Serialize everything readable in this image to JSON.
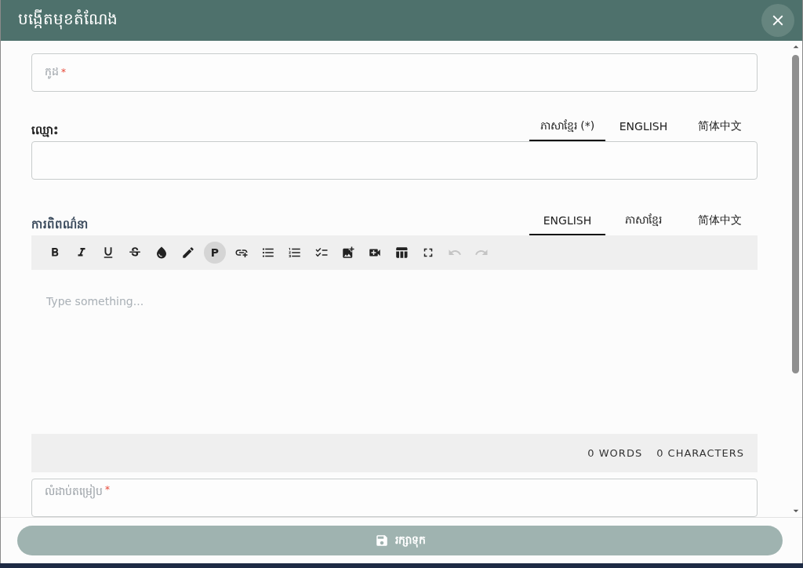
{
  "dialog": {
    "title": "បង្កើតមុខតំណែង"
  },
  "code_field": {
    "placeholder": "កូដ",
    "required_mark": "*"
  },
  "name_section": {
    "label": "ឈ្មោះ",
    "tabs": [
      {
        "label": "ភាសាខ្មែរ (*)",
        "selected": true
      },
      {
        "label": "ENGLISH",
        "selected": false
      },
      {
        "label": "简体中文",
        "selected": false
      }
    ]
  },
  "description_section": {
    "label": "ការពិពណ៌នា",
    "tabs": [
      {
        "label": "ENGLISH",
        "selected": true
      },
      {
        "label": "ភាសាខ្មែរ",
        "selected": false
      },
      {
        "label": "简体中文",
        "selected": false
      }
    ],
    "toolbar": [
      {
        "kind": "bold",
        "disabled": false
      },
      {
        "kind": "italic",
        "disabled": false
      },
      {
        "kind": "underline",
        "disabled": false
      },
      {
        "kind": "strike",
        "disabled": false
      },
      {
        "kind": "color",
        "disabled": false
      },
      {
        "kind": "highlight",
        "disabled": false
      },
      {
        "kind": "paragraph",
        "label": "P",
        "selected": true,
        "disabled": false
      },
      {
        "kind": "link",
        "disabled": false
      },
      {
        "kind": "bullets",
        "disabled": false
      },
      {
        "kind": "numbers",
        "disabled": false
      },
      {
        "kind": "tasks",
        "disabled": false
      },
      {
        "kind": "image",
        "disabled": false
      },
      {
        "kind": "video",
        "disabled": false
      },
      {
        "kind": "table",
        "disabled": false
      },
      {
        "kind": "fullscreen",
        "disabled": false
      },
      {
        "kind": "undo",
        "disabled": true
      },
      {
        "kind": "redo",
        "disabled": true
      }
    ],
    "placeholder": "Type something...",
    "words": "0 WORDS",
    "characters": "0 CHARACTERS"
  },
  "order_field": {
    "placeholder": "លំដាប់តម្រៀប",
    "required_mark": "*"
  },
  "save_button": {
    "label": "រក្សាទុក"
  }
}
